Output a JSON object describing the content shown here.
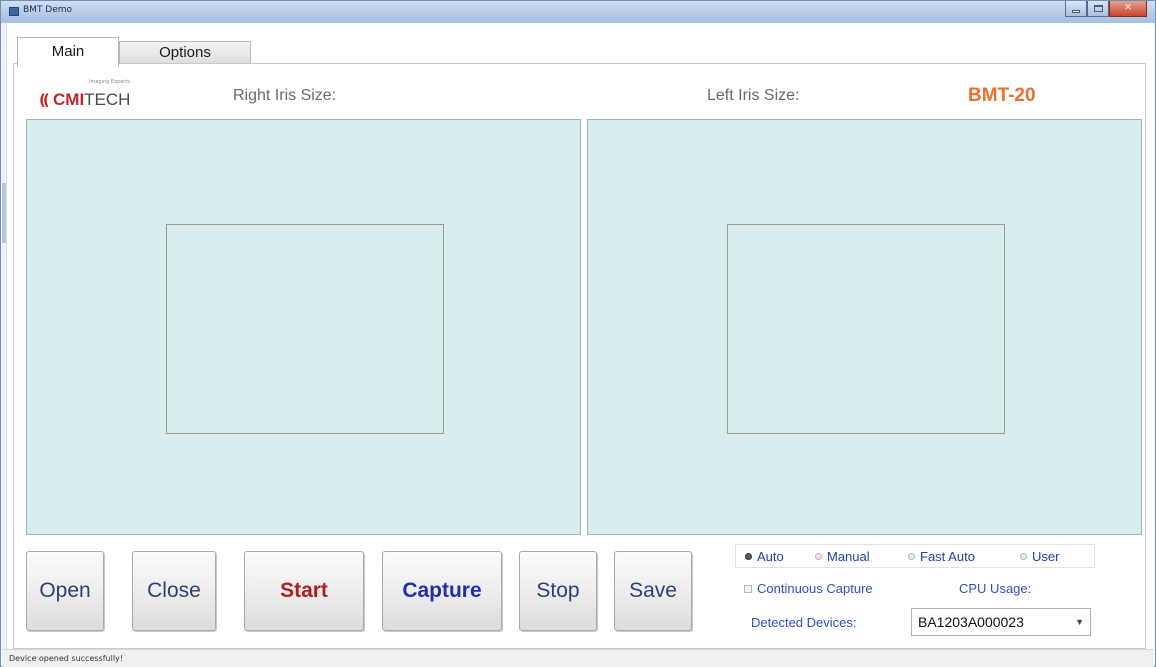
{
  "window": {
    "title": "BMT Demo"
  },
  "tabs": [
    {
      "label": "Main",
      "active": true
    },
    {
      "label": "Options",
      "active": false
    }
  ],
  "logo": {
    "tagline": "Imaging Experts",
    "brand_red": "CMI",
    "brand_gray": "TECH"
  },
  "header": {
    "right_iris_label": "Right Iris Size:",
    "left_iris_label": "Left Iris Size:",
    "model": "BMT-20"
  },
  "buttons": {
    "open": "Open",
    "close": "Close",
    "start": "Start",
    "capture": "Capture",
    "stop": "Stop",
    "save": "Save"
  },
  "mode_options": [
    {
      "label": "Auto",
      "checked": true
    },
    {
      "label": "Manual",
      "checked": false
    },
    {
      "label": "Fast Auto",
      "checked": false
    },
    {
      "label": "User",
      "checked": false
    }
  ],
  "continuous_capture": {
    "label": "Continuous Capture",
    "checked": false
  },
  "cpu_usage": {
    "label": "CPU Usage:"
  },
  "detected_devices": {
    "label": "Detected Devices:",
    "selected": "BA1203A000023"
  },
  "status": {
    "message": "Device opened successfully!"
  },
  "colors": {
    "panel_bg": "#d8eeee",
    "model_orange": "#ec6f2c",
    "start_red": "#b01e1e",
    "capture_blue": "#1e2fb0",
    "label_blue": "#2f4fbf"
  }
}
